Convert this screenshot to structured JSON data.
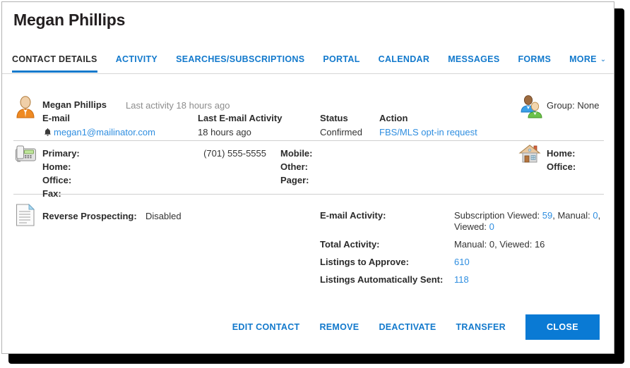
{
  "window": {
    "title": "Megan Phillips"
  },
  "tabs": [
    {
      "label": "CONTACT DETAILS",
      "active": true
    },
    {
      "label": "ACTIVITY",
      "active": false
    },
    {
      "label": "SEARCHES/SUBSCRIPTIONS",
      "active": false
    },
    {
      "label": "PORTAL",
      "active": false
    },
    {
      "label": "CALENDAR",
      "active": false
    },
    {
      "label": "MESSAGES",
      "active": false
    },
    {
      "label": "FORMS",
      "active": false
    },
    {
      "label": "MORE",
      "active": false,
      "caret": "⌄"
    }
  ],
  "contact": {
    "name": "Megan Phillips",
    "last_activity": "Last activity 18 hours ago",
    "email_label": "E-mail",
    "email_value": "megan1@mailinator.com",
    "last_email_activity_label": "Last E-mail Activity",
    "last_email_activity_value": "18 hours ago",
    "status_label": "Status",
    "status_value": "Confirmed",
    "action_label": "Action",
    "action_value": "FBS/MLS opt-in request",
    "group": "Group: None"
  },
  "phones": {
    "col1": [
      {
        "label": "Primary:",
        "value": "(701) 555-5555"
      },
      {
        "label": "Home:",
        "value": ""
      },
      {
        "label": "Office:",
        "value": ""
      },
      {
        "label": "Fax:",
        "value": ""
      }
    ],
    "col2": [
      {
        "label": "Mobile:",
        "value": ""
      },
      {
        "label": "Other:",
        "value": ""
      },
      {
        "label": "Pager:",
        "value": ""
      }
    ],
    "addresses": [
      {
        "label": "Home:",
        "value": ""
      },
      {
        "label": "Office:",
        "value": ""
      }
    ]
  },
  "details": {
    "reverse_prospecting_label": "Reverse Prospecting:",
    "reverse_prospecting_value": "Disabled",
    "stats": [
      {
        "label": "E-mail Activity:",
        "parts": [
          {
            "text": "Subscription Viewed: ",
            "link": false
          },
          {
            "text": "59",
            "link": true
          },
          {
            "text": ", Manual: ",
            "link": false
          },
          {
            "text": "0",
            "link": true
          },
          {
            "text": ", Viewed: ",
            "link": false
          },
          {
            "text": "0",
            "link": true
          }
        ]
      },
      {
        "label": "Total Activity:",
        "parts": [
          {
            "text": "Manual: 0, Viewed: 16",
            "link": false
          }
        ]
      },
      {
        "label": "Listings to Approve:",
        "parts": [
          {
            "text": "610",
            "link": true
          }
        ]
      },
      {
        "label": "Listings Automatically Sent:",
        "parts": [
          {
            "text": "118",
            "link": true
          }
        ]
      }
    ]
  },
  "footer": {
    "buttons": [
      {
        "label": "EDIT CONTACT",
        "primary": false
      },
      {
        "label": "REMOVE",
        "primary": false
      },
      {
        "label": "DEACTIVATE",
        "primary": false
      },
      {
        "label": "TRANSFER",
        "primary": false
      },
      {
        "label": "CLOSE",
        "primary": true
      }
    ]
  },
  "colors": {
    "link": "#2f8ee0",
    "tab_link": "#1279cc",
    "primary_button": "#0a7ad4",
    "text": "#2b2b2b",
    "muted": "#8d8d8d"
  }
}
